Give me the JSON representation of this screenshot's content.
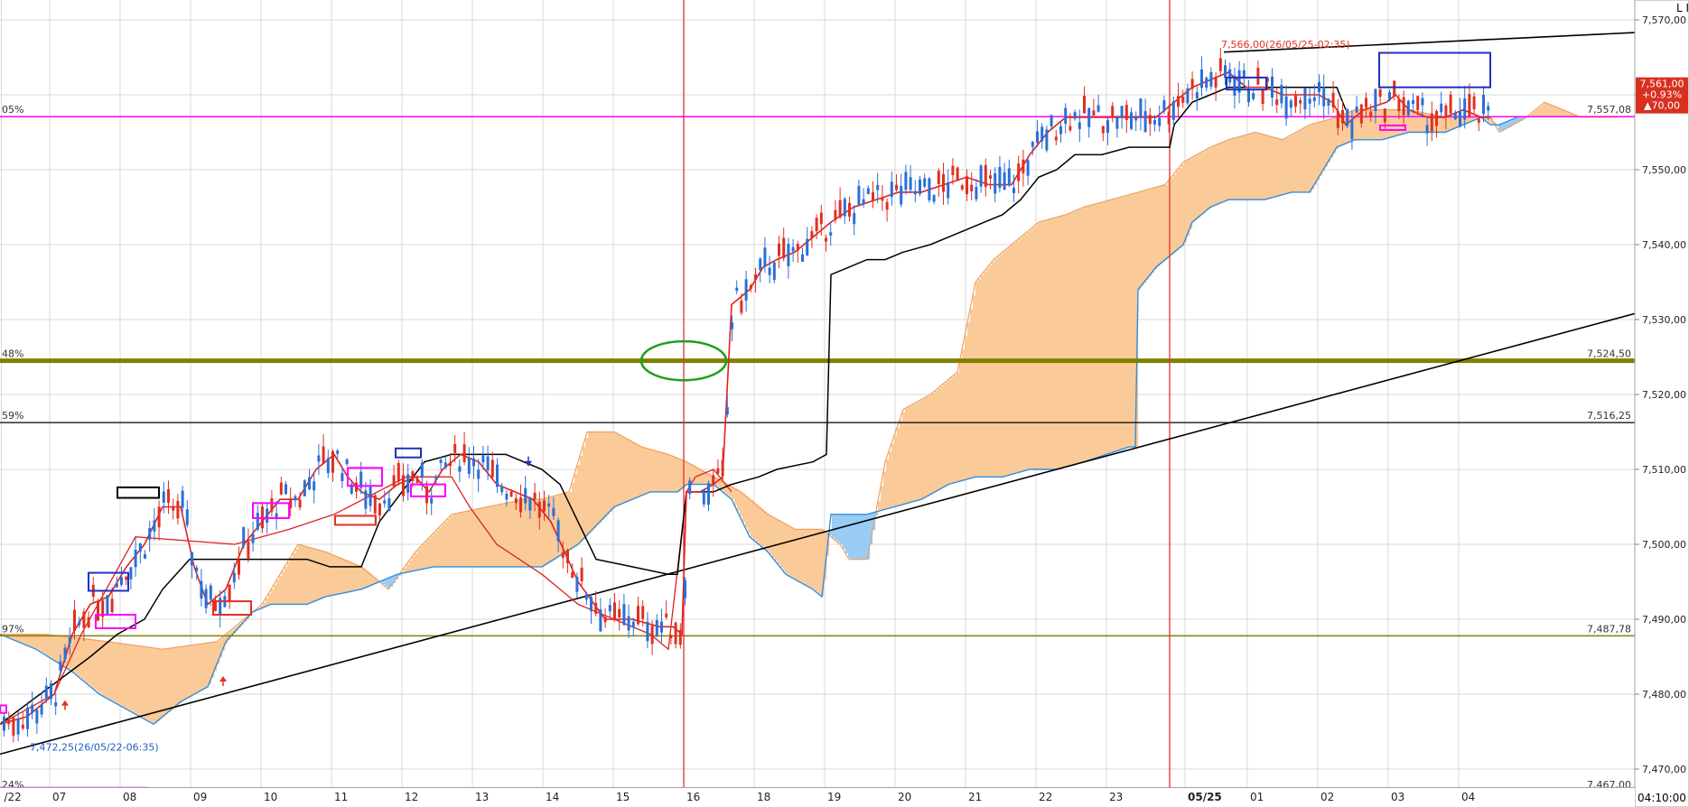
{
  "window": {
    "corner_label": "L I",
    "time_label": "04:10:00"
  },
  "chart_data": {
    "type": "candlestick",
    "ylim": [
      7465,
      7572
    ],
    "yticks": [
      7470,
      7480,
      7490,
      7500,
      7510,
      7520,
      7530,
      7540,
      7550,
      7560,
      7570
    ],
    "ytick_labels": [
      "7,470,00",
      "7,480,00",
      "7,490,00",
      "7,500,00",
      "7,510,00",
      "7,520,00",
      "7,530,00",
      "7,540,00",
      "7,550,00",
      "7,560,00",
      "7,570,00"
    ],
    "xticks": [
      {
        "label": "/22",
        "x": 1.5
      },
      {
        "label": "07",
        "x": 55
      },
      {
        "label": "08",
        "x": 133
      },
      {
        "label": "09",
        "x": 211
      },
      {
        "label": "10",
        "x": 289
      },
      {
        "label": "11",
        "x": 367
      },
      {
        "label": "12",
        "x": 445
      },
      {
        "label": "13",
        "x": 523
      },
      {
        "label": "14",
        "x": 601
      },
      {
        "label": "15",
        "x": 679
      },
      {
        "label": "16",
        "x": 757
      },
      {
        "label": "18",
        "x": 835
      },
      {
        "label": "19",
        "x": 913
      },
      {
        "label": "20",
        "x": 991
      },
      {
        "label": "21",
        "x": 1069
      },
      {
        "label": "22",
        "x": 1147
      },
      {
        "label": "23",
        "x": 1225
      },
      {
        "label": "05/25",
        "x": 1312
      },
      {
        "label": "01",
        "x": 1381
      },
      {
        "label": "02",
        "x": 1459
      },
      {
        "label": "03",
        "x": 1537
      },
      {
        "label": "04",
        "x": 1615
      }
    ],
    "x_range": [
      0,
      1810
    ],
    "levels": [
      {
        "pct": "05%",
        "value": 7557.08,
        "label": "7,557,08",
        "color": "#ff00ff",
        "width": 1.5
      },
      {
        "pct": "48%",
        "value": 7524.5,
        "label": "7,524,50",
        "color": "#808000",
        "width": 5
      },
      {
        "pct": "59%",
        "value": 7516.25,
        "label": "7,516,25",
        "color": "#000000",
        "width": 1.2
      },
      {
        "pct": "97%",
        "value": 7487.78,
        "label": "7,487,78",
        "color": "#808000",
        "width": 1.5
      },
      {
        "pct": "24%",
        "value": 7467.0,
        "label": "7,467,00",
        "color": "#ff00ff",
        "width": 1.5
      }
    ],
    "annotations": [
      {
        "text": "7,566,00(26/05/25-02:35)",
        "x": 1352,
        "y": 7566.0,
        "color": "#e03020"
      },
      {
        "text": "7,472,25(26/05/22-06:35)",
        "x": 33,
        "y": 7472.25,
        "color": "#2060c0"
      }
    ],
    "price_box": {
      "lines": [
        "7,561,00",
        "+0.93%",
        "▲70,00"
      ],
      "value": 7561.0
    },
    "vlines": [
      {
        "x": 757,
        "color": "#e03030"
      },
      {
        "x": 1295,
        "color": "#e03030"
      }
    ],
    "trendlines": [
      {
        "x1": 0,
        "y1": 7472.0,
        "x2": 1810,
        "y2": 7530.8,
        "color": "#000000"
      },
      {
        "x1": 1355,
        "y1": 7565.7,
        "x2": 1810,
        "y2": 7568.3,
        "color": "#000000"
      }
    ],
    "tenkan": [
      [
        0,
        7476
      ],
      [
        30,
        7477
      ],
      [
        60,
        7480
      ],
      [
        80,
        7488
      ],
      [
        100,
        7492
      ],
      [
        120,
        7493
      ],
      [
        140,
        7497
      ],
      [
        160,
        7500
      ],
      [
        180,
        7505
      ],
      [
        200,
        7505
      ],
      [
        215,
        7497
      ],
      [
        230,
        7492
      ],
      [
        250,
        7494
      ],
      [
        270,
        7500
      ],
      [
        290,
        7503
      ],
      [
        310,
        7506
      ],
      [
        330,
        7506
      ],
      [
        350,
        7510
      ],
      [
        370,
        7512
      ],
      [
        385,
        7509
      ],
      [
        400,
        7507
      ],
      [
        420,
        7506
      ],
      [
        440,
        7508
      ],
      [
        460,
        7509
      ],
      [
        475,
        7507
      ],
      [
        490,
        7510
      ],
      [
        510,
        7512
      ],
      [
        530,
        7511
      ],
      [
        550,
        7508
      ],
      [
        570,
        7507
      ],
      [
        590,
        7506
      ],
      [
        610,
        7503
      ],
      [
        640,
        7495
      ],
      [
        670,
        7490
      ],
      [
        700,
        7490
      ],
      [
        730,
        7489
      ],
      [
        745,
        7489
      ],
      [
        755,
        7488
      ],
      [
        760,
        7507
      ],
      [
        775,
        7507
      ],
      [
        790,
        7508
      ],
      [
        800,
        7509
      ],
      [
        810,
        7532
      ],
      [
        830,
        7534
      ],
      [
        845,
        7537
      ],
      [
        860,
        7538
      ],
      [
        880,
        7539
      ],
      [
        900,
        7541
      ],
      [
        920,
        7543
      ],
      [
        945,
        7545
      ],
      [
        970,
        7546
      ],
      [
        995,
        7547
      ],
      [
        1020,
        7547
      ],
      [
        1045,
        7548
      ],
      [
        1070,
        7549
      ],
      [
        1095,
        7548
      ],
      [
        1120,
        7548
      ],
      [
        1140,
        7552
      ],
      [
        1160,
        7555
      ],
      [
        1180,
        7557
      ],
      [
        1200,
        7557
      ],
      [
        1220,
        7557
      ],
      [
        1250,
        7557
      ],
      [
        1280,
        7557
      ],
      [
        1300,
        7559
      ],
      [
        1320,
        7561
      ],
      [
        1340,
        7562
      ],
      [
        1360,
        7563
      ],
      [
        1380,
        7561
      ],
      [
        1400,
        7561
      ],
      [
        1420,
        7560
      ],
      [
        1440,
        7560
      ],
      [
        1460,
        7560
      ],
      [
        1475,
        7559
      ],
      [
        1490,
        7556
      ],
      [
        1510,
        7558
      ],
      [
        1535,
        7559
      ],
      [
        1545,
        7560
      ],
      [
        1560,
        7558
      ],
      [
        1580,
        7557
      ],
      [
        1600,
        7557
      ],
      [
        1620,
        7558
      ],
      [
        1640,
        7557
      ],
      [
        1650,
        7557
      ]
    ],
    "kijun": [
      [
        0,
        7476
      ],
      [
        100,
        7485
      ],
      [
        130,
        7488
      ],
      [
        160,
        7490
      ],
      [
        180,
        7494
      ],
      [
        210,
        7498
      ],
      [
        340,
        7498
      ],
      [
        365,
        7497
      ],
      [
        400,
        7497
      ],
      [
        420,
        7503
      ],
      [
        470,
        7511
      ],
      [
        500,
        7512
      ],
      [
        560,
        7512
      ],
      [
        600,
        7510
      ],
      [
        620,
        7508
      ],
      [
        640,
        7503
      ],
      [
        660,
        7498
      ],
      [
        700,
        7497
      ],
      [
        740,
        7496
      ],
      [
        750,
        7496
      ],
      [
        760,
        7507
      ],
      [
        790,
        7507
      ],
      [
        810,
        7508
      ],
      [
        840,
        7509
      ],
      [
        860,
        7510
      ],
      [
        900,
        7511
      ],
      [
        915,
        7512
      ],
      [
        920,
        7536
      ],
      [
        940,
        7537
      ],
      [
        960,
        7538
      ],
      [
        980,
        7538
      ],
      [
        1000,
        7539
      ],
      [
        1030,
        7540
      ],
      [
        1050,
        7541
      ],
      [
        1070,
        7542
      ],
      [
        1090,
        7543
      ],
      [
        1110,
        7544
      ],
      [
        1130,
        7546
      ],
      [
        1150,
        7549
      ],
      [
        1170,
        7550
      ],
      [
        1190,
        7552
      ],
      [
        1220,
        7552
      ],
      [
        1250,
        7553
      ],
      [
        1280,
        7553
      ],
      [
        1295,
        7553
      ],
      [
        1300,
        7556
      ],
      [
        1320,
        7559
      ],
      [
        1340,
        7560
      ],
      [
        1360,
        7561
      ],
      [
        1380,
        7561
      ],
      [
        1400,
        7561
      ],
      [
        1450,
        7561
      ],
      [
        1480,
        7561
      ],
      [
        1490,
        7558
      ]
    ],
    "chikou": [
      [
        0,
        7476
      ],
      [
        60,
        7480
      ],
      [
        90,
        7488
      ],
      [
        150,
        7501
      ],
      [
        260,
        7500
      ],
      [
        320,
        7502
      ],
      [
        370,
        7504
      ],
      [
        450,
        7509
      ],
      [
        500,
        7509
      ],
      [
        520,
        7505
      ],
      [
        550,
        7500
      ],
      [
        600,
        7496
      ],
      [
        640,
        7492
      ],
      [
        660,
        7491
      ],
      [
        680,
        7490
      ],
      [
        720,
        7488
      ],
      [
        740,
        7486
      ],
      [
        760,
        7507
      ],
      [
        770,
        7509
      ],
      [
        790,
        7510
      ],
      [
        810,
        7507
      ]
    ],
    "span_a": [
      [
        0,
        7488
      ],
      [
        50,
        7488
      ],
      [
        120,
        7487
      ],
      [
        180,
        7486
      ],
      [
        240,
        7487
      ],
      [
        290,
        7492
      ],
      [
        330,
        7500
      ],
      [
        360,
        7499
      ],
      [
        400,
        7497
      ],
      [
        430,
        7494
      ],
      [
        460,
        7499
      ],
      [
        500,
        7504
      ],
      [
        540,
        7505
      ],
      [
        580,
        7506
      ],
      [
        600,
        7506
      ],
      [
        630,
        7507
      ],
      [
        650,
        7515
      ],
      [
        680,
        7515
      ],
      [
        710,
        7513
      ],
      [
        740,
        7512
      ],
      [
        760,
        7511
      ],
      [
        790,
        7509
      ],
      [
        820,
        7507
      ],
      [
        850,
        7504
      ],
      [
        880,
        7502
      ],
      [
        910,
        7502
      ],
      [
        930,
        7500
      ],
      [
        940,
        7498
      ],
      [
        960,
        7498
      ],
      [
        980,
        7511
      ],
      [
        1000,
        7518
      ],
      [
        1030,
        7520
      ],
      [
        1060,
        7523
      ],
      [
        1080,
        7535
      ],
      [
        1100,
        7538
      ],
      [
        1120,
        7540
      ],
      [
        1150,
        7543
      ],
      [
        1180,
        7544
      ],
      [
        1200,
        7545
      ],
      [
        1230,
        7546
      ],
      [
        1260,
        7547
      ],
      [
        1290,
        7548
      ],
      [
        1310,
        7551
      ],
      [
        1340,
        7553
      ],
      [
        1360,
        7554
      ],
      [
        1390,
        7555
      ],
      [
        1420,
        7554
      ],
      [
        1450,
        7556
      ],
      [
        1480,
        7557
      ],
      [
        1500,
        7558
      ],
      [
        1530,
        7558
      ],
      [
        1560,
        7558
      ],
      [
        1600,
        7557
      ],
      [
        1630,
        7557
      ],
      [
        1650,
        7557
      ],
      [
        1660,
        7555
      ],
      [
        1690,
        7557
      ],
      [
        1710,
        7559
      ],
      [
        1730,
        7558
      ],
      [
        1750,
        7557
      ],
      [
        1790,
        7557
      ]
    ],
    "span_b": [
      [
        0,
        7488
      ],
      [
        40,
        7486
      ],
      [
        80,
        7483
      ],
      [
        110,
        7480
      ],
      [
        140,
        7478
      ],
      [
        170,
        7476
      ],
      [
        200,
        7479
      ],
      [
        230,
        7481
      ],
      [
        250,
        7487
      ],
      [
        280,
        7491
      ],
      [
        300,
        7492
      ],
      [
        320,
        7492
      ],
      [
        340,
        7492
      ],
      [
        360,
        7493
      ],
      [
        400,
        7494
      ],
      [
        440,
        7496
      ],
      [
        480,
        7497
      ],
      [
        520,
        7497
      ],
      [
        560,
        7497
      ],
      [
        600,
        7497
      ],
      [
        640,
        7500
      ],
      [
        680,
        7505
      ],
      [
        720,
        7507
      ],
      [
        750,
        7507
      ],
      [
        760,
        7508
      ],
      [
        790,
        7508
      ],
      [
        810,
        7506
      ],
      [
        830,
        7501
      ],
      [
        850,
        7499
      ],
      [
        870,
        7496
      ],
      [
        900,
        7494
      ],
      [
        910,
        7493
      ],
      [
        920,
        7504
      ],
      [
        960,
        7504
      ],
      [
        990,
        7505
      ],
      [
        1020,
        7506
      ],
      [
        1050,
        7508
      ],
      [
        1080,
        7509
      ],
      [
        1110,
        7509
      ],
      [
        1140,
        7510
      ],
      [
        1170,
        7510
      ],
      [
        1200,
        7511
      ],
      [
        1250,
        7513
      ],
      [
        1257,
        7513
      ],
      [
        1260,
        7534
      ],
      [
        1280,
        7537
      ],
      [
        1300,
        7539
      ],
      [
        1310,
        7540
      ],
      [
        1320,
        7543
      ],
      [
        1340,
        7545
      ],
      [
        1360,
        7546
      ],
      [
        1400,
        7546
      ],
      [
        1430,
        7547
      ],
      [
        1450,
        7547
      ],
      [
        1460,
        7549
      ],
      [
        1480,
        7553
      ],
      [
        1500,
        7554
      ],
      [
        1530,
        7554
      ],
      [
        1560,
        7555
      ],
      [
        1600,
        7555
      ],
      [
        1620,
        7556
      ],
      [
        1640,
        7557
      ],
      [
        1650,
        7556
      ],
      [
        1660,
        7556
      ],
      [
        1680,
        7557
      ]
    ],
    "boxes": [
      {
        "x1": 130,
        "x2": 176,
        "y1": 7507.6,
        "y2": 7506.2,
        "color": "#000000",
        "fill": "#ffffff"
      },
      {
        "x1": 98,
        "x2": 142,
        "y1": 7496.2,
        "y2": 7493.8,
        "color": "#2030c0",
        "fill": "none"
      },
      {
        "x1": 106,
        "x2": 150,
        "y1": 7490.6,
        "y2": 7488.8,
        "color": "#ff00ff",
        "fill": "none"
      },
      {
        "x1": 236,
        "x2": 278,
        "y1": 7492.4,
        "y2": 7490.6,
        "color": "#e03020",
        "fill": "none"
      },
      {
        "x1": 280,
        "x2": 320,
        "y1": 7505.5,
        "y2": 7503.5,
        "color": "#ff00ff",
        "fill": "none"
      },
      {
        "x1": 385,
        "x2": 423,
        "y1": 7510.2,
        "y2": 7507.8,
        "color": "#ff00ff",
        "fill": "none"
      },
      {
        "x1": 371,
        "x2": 416,
        "y1": 7503.8,
        "y2": 7502.6,
        "color": "#e03020",
        "fill": "none"
      },
      {
        "x1": 438,
        "x2": 466,
        "y1": 7512.8,
        "y2": 7511.6,
        "color": "#2030c0",
        "fill": "none"
      },
      {
        "x1": 455,
        "x2": 493,
        "y1": 7508.0,
        "y2": 7506.4,
        "color": "#ff00ff",
        "fill": "none"
      },
      {
        "x1": 1358,
        "x2": 1402,
        "y1": 7562.3,
        "y2": 7560.7,
        "color": "#2030c0",
        "fill": "none"
      },
      {
        "x1": 1527,
        "x2": 1650,
        "y1": 7565.6,
        "y2": 7561.0,
        "color": "#2030c0",
        "fill": "none"
      },
      {
        "x1": 1528,
        "x2": 1556,
        "y1": 7555.9,
        "y2": 7555.3,
        "color": "#ff00ff",
        "fill": "none"
      },
      {
        "x1": 0,
        "x2": 163,
        "y1": 7467.5,
        "y2": 7466.6,
        "color": "#ff00ff",
        "fill": "none"
      },
      {
        "x1": 0,
        "x2": 7,
        "y1": 7478.5,
        "y2": 7477.5,
        "color": "#ff00ff",
        "fill": "none"
      }
    ],
    "ellipse": {
      "cx": 757,
      "cy": 7524.5,
      "rx": 47,
      "ry": 2.6,
      "color": "#20a020"
    },
    "arrows": [
      {
        "x": 72,
        "y": 7478.6,
        "dir": "up",
        "color": "#e03020"
      },
      {
        "x": 247,
        "y": 7481.8,
        "dir": "up",
        "color": "#e03020"
      },
      {
        "x": 585,
        "y": 7511.0,
        "dir": "down",
        "color": "#2030c0"
      }
    ]
  }
}
